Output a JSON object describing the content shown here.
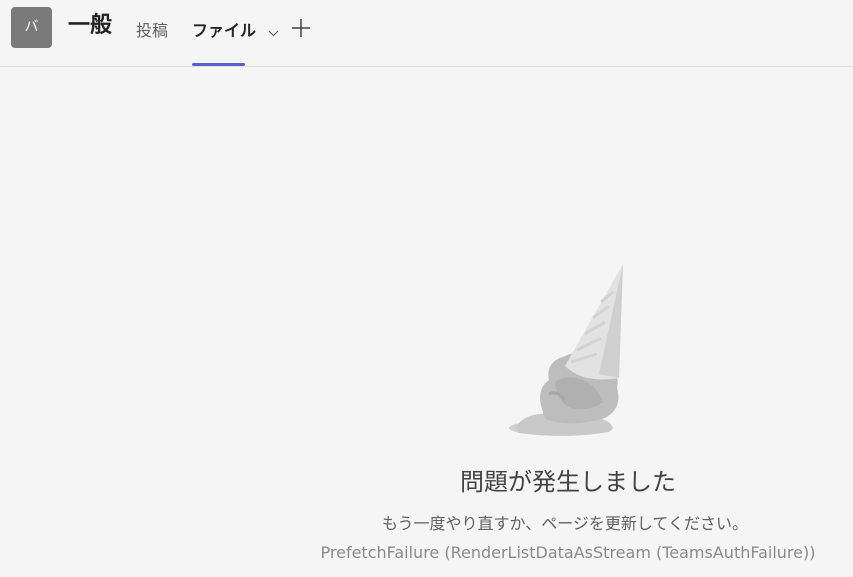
{
  "header": {
    "avatar_initial": "バ",
    "channel_title": "一般",
    "tabs": [
      {
        "label": "投稿",
        "active": false
      },
      {
        "label": "ファイル",
        "active": true,
        "has_dropdown": true
      }
    ],
    "add_tab_icon": "plus-icon",
    "accent_color": "#5b5fc7"
  },
  "main": {
    "illustration": "dropped-ice-cream-cone",
    "error_title": "問題が発生しました",
    "error_message": "もう一度やり直すか、ページを更新してください。",
    "error_code": "PrefetchFailure (RenderListDataAsStream (TeamsAuthFailure))"
  }
}
